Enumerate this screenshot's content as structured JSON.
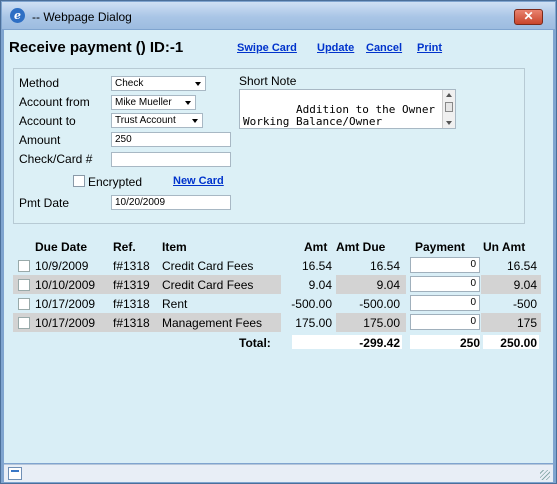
{
  "window": {
    "title": "-- Webpage Dialog",
    "close_glyph": "✕",
    "app_icon": "ie-icon",
    "status_icon": "page-icon"
  },
  "header": {
    "title": "Receive payment  () ID:-1",
    "links": {
      "swipe": "Swipe Card",
      "update": "Update",
      "cancel": "Cancel",
      "print": "Print"
    }
  },
  "form": {
    "method": {
      "label": "Method",
      "value": "Check"
    },
    "account_from": {
      "label": "Account from",
      "value": "Mike Mueller"
    },
    "account_to": {
      "label": "Account to",
      "value": "Trust Account"
    },
    "amount": {
      "label": "Amount",
      "value": "250"
    },
    "check_card": {
      "label": "Check/Card #",
      "value": ""
    },
    "encrypted": {
      "label": "Encrypted",
      "checked": false
    },
    "new_card": "New Card",
    "pmt_date": {
      "label": "Pmt Date",
      "value": "10/20/2009"
    },
    "short_note": {
      "label": "Short Note",
      "value": "Addition to the Owner\nWorking Balance/Owner\nFund."
    }
  },
  "table": {
    "headers": {
      "due_date": "Due Date",
      "ref": "Ref.",
      "item": "Item",
      "amt": "Amt",
      "amt_due": "Amt Due",
      "payment": "Payment",
      "un_amt": "Un Amt"
    },
    "rows": [
      {
        "due_date": "10/9/2009",
        "ref": "f#1318",
        "item": "Credit Card Fees",
        "amt": "16.54",
        "amt_due": "16.54",
        "payment": "0",
        "un_amt": "16.54"
      },
      {
        "due_date": "10/10/2009",
        "ref": "f#1319",
        "item": "Credit Card Fees",
        "amt": "9.04",
        "amt_due": "9.04",
        "payment": "0",
        "un_amt": "9.04"
      },
      {
        "due_date": "10/17/2009",
        "ref": "f#1318",
        "item": "Rent",
        "amt": "-500.00",
        "amt_due": "-500.00",
        "payment": "0",
        "un_amt": "-500"
      },
      {
        "due_date": "10/17/2009",
        "ref": "f#1318",
        "item": "Management Fees",
        "amt": "175.00",
        "amt_due": "175.00",
        "payment": "0",
        "un_amt": "175"
      }
    ],
    "total": {
      "label": "Total:",
      "amt_due": "-299.42",
      "payment": "250",
      "un_amt": "250.00"
    }
  }
}
